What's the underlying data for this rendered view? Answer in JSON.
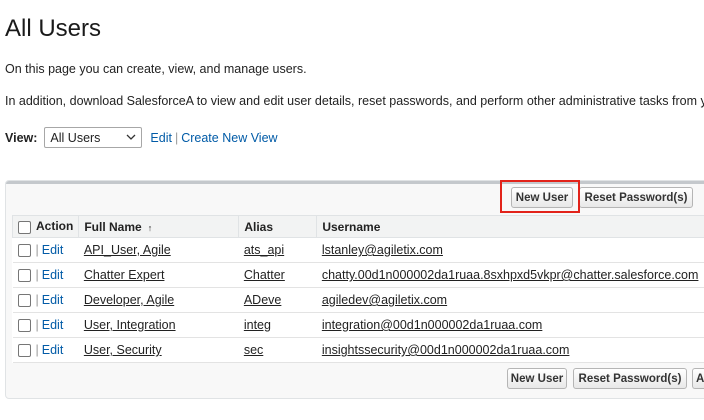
{
  "page": {
    "title": "All Users",
    "description1": "On this page you can create, view, and manage users.",
    "description2": "In addition, download SalesforceA to view and edit user details, reset passwords, and perform other administrative tasks from your mobile device."
  },
  "view": {
    "label": "View:",
    "selected": "All Users",
    "edit_link": "Edit",
    "separator": "|",
    "create_link": "Create New View"
  },
  "toolbar": {
    "new_user_label": "New User",
    "reset_password_label": "Reset Password(s)",
    "next_button_label": "A"
  },
  "table": {
    "headers": {
      "action": "Action",
      "full_name": "Full Name",
      "sort_arrow": "↑",
      "alias": "Alias",
      "username": "Username"
    },
    "edit_label": "Edit",
    "pipe": "|",
    "rows": [
      {
        "full_name": "API_User, Agile",
        "alias": "ats_api",
        "username": "lstanley@agiletix.com"
      },
      {
        "full_name": "Chatter Expert",
        "alias": "Chatter",
        "username": "chatty.00d1n000002da1ruaa.8sxhpxd5vkpr@chatter.salesforce.com"
      },
      {
        "full_name": "Developer, Agile",
        "alias": "ADeve",
        "username": "agiledev@agiletix.com"
      },
      {
        "full_name": "User, Integration",
        "alias": "integ",
        "username": "integration@00d1n000002da1ruaa.com"
      },
      {
        "full_name": "User, Security",
        "alias": "sec",
        "username": "insightssecurity@00d1n000002da1ruaa.com"
      }
    ]
  },
  "colors": {
    "link": "#015ba7",
    "highlight_border": "#e2231a",
    "panel_bg": "#f8f8f8"
  }
}
